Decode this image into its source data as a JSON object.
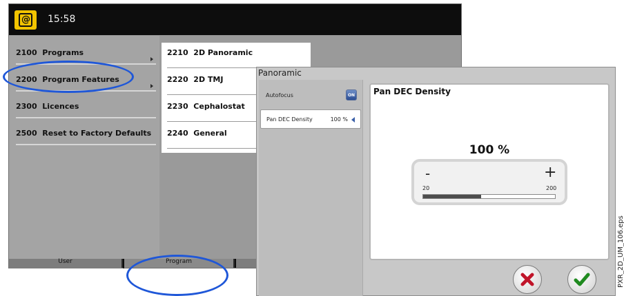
{
  "topbar": {
    "logo": "@",
    "time": "15:58"
  },
  "left_menu": [
    {
      "code": "2100",
      "label": "Programs",
      "has_submenu": true
    },
    {
      "code": "2200",
      "label": "Program Features",
      "has_submenu": true
    },
    {
      "code": "2300",
      "label": "Licences",
      "has_submenu": false
    },
    {
      "code": "2500",
      "label": "Reset to Factory Defaults",
      "has_submenu": false
    }
  ],
  "sub_menu": [
    {
      "code": "2210",
      "label": "2D Panoramic"
    },
    {
      "code": "2220",
      "label": "2D TMJ"
    },
    {
      "code": "2230",
      "label": "Cephalostat"
    },
    {
      "code": "2240",
      "label": "General"
    }
  ],
  "tabs": [
    {
      "label": "User"
    },
    {
      "label": "Program"
    }
  ],
  "dialog": {
    "title": "Panoramic",
    "settings": [
      {
        "label": "Autofocus",
        "toggle": "ON"
      },
      {
        "label": "Pan DEC Density",
        "value": "100 %"
      }
    ],
    "detail": {
      "title": "Pan DEC Density",
      "value": "100 %",
      "minus": "-",
      "plus": "+",
      "min": "20",
      "max": "200",
      "level_fraction": 0.44
    }
  },
  "side_reference": "PXR_2D_UM_106.eps",
  "colors": {
    "accent": "#1f57d8",
    "topbar": "#0d0d0d",
    "logo": "#f2c400",
    "cancel": "#c0152a",
    "confirm": "#1f8a1f"
  }
}
